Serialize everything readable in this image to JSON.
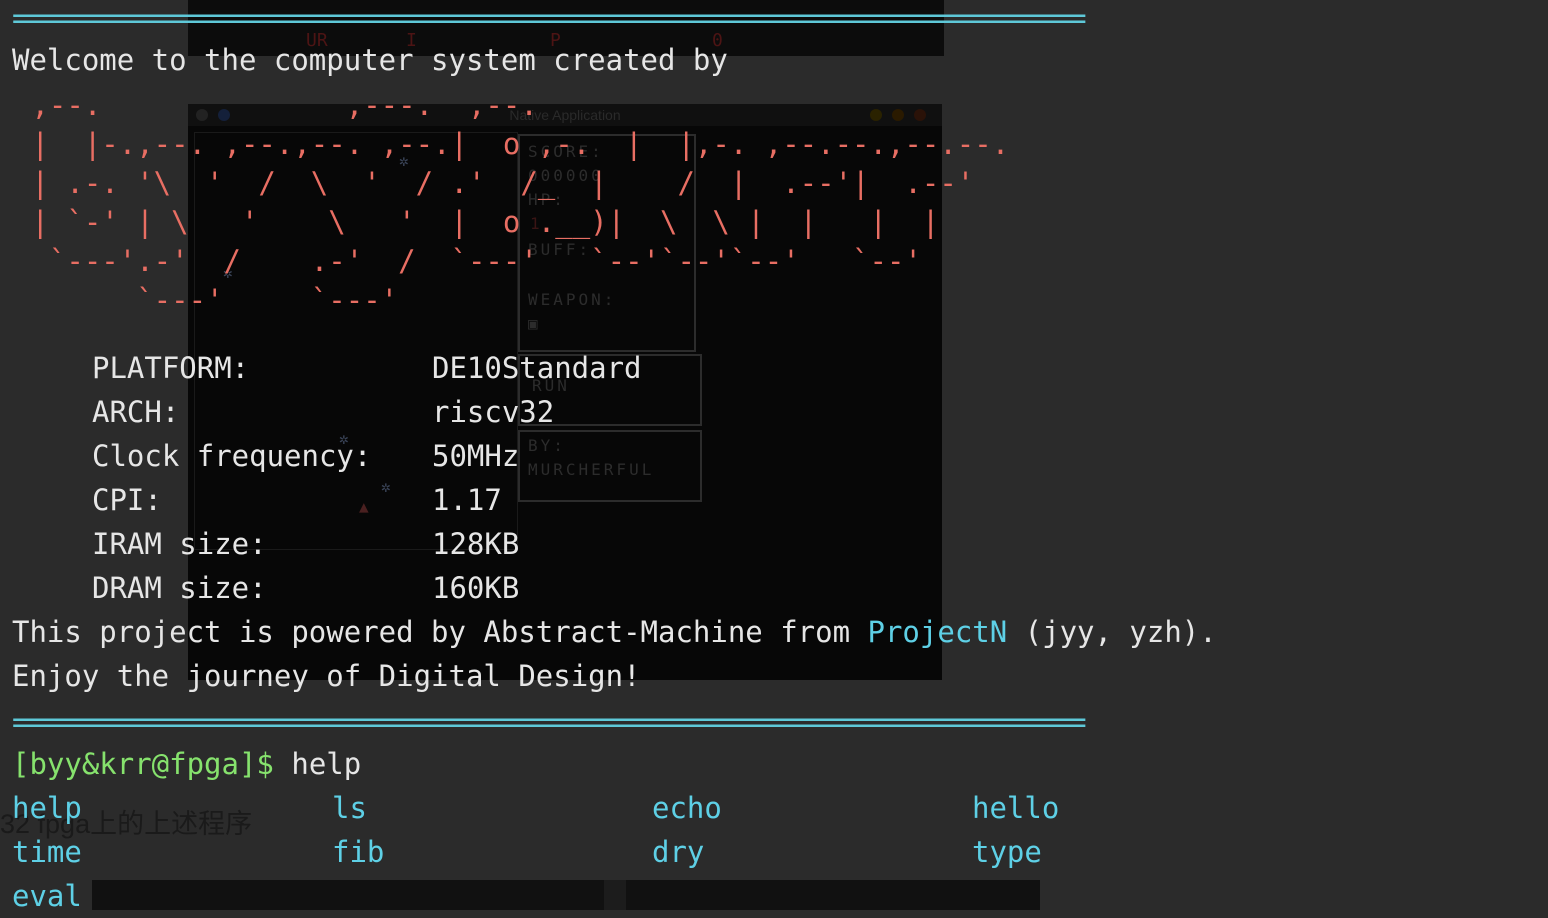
{
  "top_window": {
    "labels": [
      "UR",
      "I",
      "P",
      "0"
    ]
  },
  "app_window": {
    "title": "Native Application",
    "hud": {
      "score_label": "SCORE:",
      "score_value": "000000",
      "hp_label": "HP:",
      "hp_value": "1",
      "buff_label": "BUFF:",
      "weapon_label": "WEAPON:",
      "run_label": "RUN",
      "by_label": "BY:",
      "by_value": "MURCHERFUL"
    }
  },
  "terminal": {
    "separator": "==============================================================================",
    "welcome": "Welcome to the computer system created by",
    "ascii_art": [
      " ,--.              ,---.  ,--.",
      " |  |-.,--. ,--.,--. ,--.|  o ,-.  |  |,-. ,--.--.,--.--.",
      " | .-. '\\  '  /  \\  '  / .'  /_  |    /  |  .--'|  .--'",
      " | `-' | \\   '    \\   '  |  o .__)|  \\  \\ |  |   |  |",
      "  `---'.-'  /    .-'  /  `---'   `--'`--'`--'   `--'",
      "       `---'     `---'"
    ],
    "info": [
      {
        "label": "PLATFORM:",
        "value": "DE10Standard"
      },
      {
        "label": "ARCH:",
        "value": "riscv32"
      },
      {
        "label": "Clock frequency:",
        "value": "50MHz"
      },
      {
        "label": "CPI:",
        "value": "1.17"
      },
      {
        "label": "IRAM size:",
        "value": "128KB"
      },
      {
        "label": "DRAM size:",
        "value": "160KB"
      }
    ],
    "powered_pre": "This project is powered by Abstract-Machine from ",
    "powered_link": "ProjectN",
    "powered_post": " (jyy, yzh).",
    "enjoy": "Enjoy the journey of Digital Design!",
    "prompt": "[byy&krr@fpga]$",
    "command": " help",
    "commands": [
      "help",
      "ls",
      "echo",
      "hello",
      "time",
      "fib",
      "dry",
      "type",
      "eval"
    ]
  },
  "background_caption": "32 fpga上的上述程序",
  "colors": {
    "background": "#2b2b2b",
    "text": "#e6e6e6",
    "ascii_art": "#e86e63",
    "accent_cyan": "#5ed0e6",
    "prompt_green": "#86e26d"
  }
}
